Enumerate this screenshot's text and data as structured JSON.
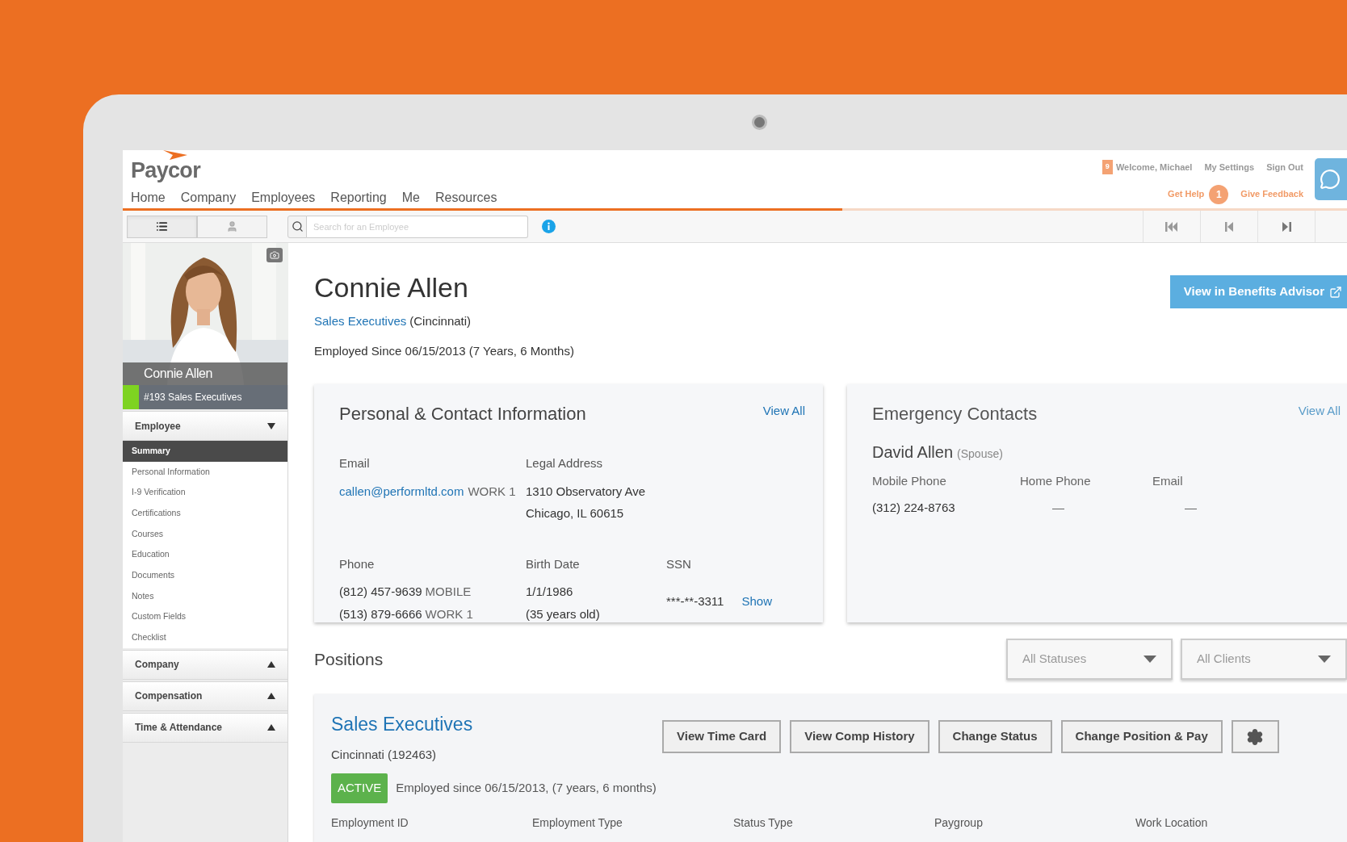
{
  "header": {
    "logo": "Paycor",
    "nav": [
      "Home",
      "Company",
      "Employees",
      "Reporting",
      "Me",
      "Resources"
    ],
    "notification_count": "9",
    "welcome": "Welcome, Michael",
    "links": [
      "My Settings",
      "Sign Out"
    ],
    "get_help": "Get Help",
    "help_count": "1",
    "give_feedback": "Give Feedback"
  },
  "toolbar": {
    "views": [
      {
        "kind": "list",
        "selected": true
      },
      {
        "kind": "person",
        "selected": false
      }
    ],
    "search": {
      "placeholder": "Search for an Employee"
    }
  },
  "sidebar": {
    "name": "Connie Allen",
    "subtitle": "#193 Sales Executives",
    "sections": [
      {
        "label": "Employee",
        "expanded": true,
        "items": [
          {
            "label": "Summary",
            "selected": true
          },
          {
            "label": "Personal Information",
            "selected": false
          },
          {
            "label": "I-9 Verification",
            "selected": false
          },
          {
            "label": "Certifications",
            "selected": false
          },
          {
            "label": "Courses",
            "selected": false
          },
          {
            "label": "Education",
            "selected": false
          },
          {
            "label": "Documents",
            "selected": false
          },
          {
            "label": "Notes",
            "selected": false
          },
          {
            "label": "Custom Fields",
            "selected": false
          },
          {
            "label": "Checklist",
            "selected": false
          }
        ]
      },
      {
        "label": "Company",
        "expanded": false
      },
      {
        "label": "Compensation",
        "expanded": false
      },
      {
        "label": "Time & Attendance",
        "expanded": false
      }
    ]
  },
  "profile": {
    "name": "Connie Allen",
    "department": "Sales Executives",
    "location": "(Cincinnati)",
    "employed_since": "Employed Since 06/15/2013 (7 Years, 6 Months)",
    "benefits_button": "View in Benefits Advisor"
  },
  "personal_card": {
    "title": "Personal & Contact Information",
    "view_all": "View All",
    "email_label": "Email",
    "email": "callen@performltd.com",
    "email_type": "WORK 1",
    "address_label": "Legal Address",
    "address_lines": [
      "1310 Observatory Ave",
      "Chicago, IL 60615"
    ],
    "phone_label": "Phone",
    "phones": [
      {
        "number": "(812) 457-9639",
        "type": "MOBILE"
      },
      {
        "number": "(513) 879-6666",
        "type": "WORK 1"
      }
    ],
    "birth_label": "Birth Date",
    "birth_date": "1/1/1986",
    "age": "(35 years old)",
    "ssn_label": "SSN",
    "ssn": "***-**-3311",
    "ssn_show": "Show"
  },
  "emergency_card": {
    "title": "Emergency Contacts",
    "view_all": "View All",
    "contact_name": "David Allen",
    "relation": "(Spouse)",
    "columns": [
      {
        "label": "Mobile Phone",
        "value": "(312) 224-8763"
      },
      {
        "label": "Home Phone",
        "value": "—"
      },
      {
        "label": "Email",
        "value": "—"
      }
    ]
  },
  "positions": {
    "title": "Positions",
    "filters": [
      "All Statuses",
      "All Clients"
    ],
    "position": {
      "title": "Sales Executives",
      "subtitle": "Cincinnati (192463)",
      "buttons": [
        "View Time Card",
        "View Comp History",
        "Change Status",
        "Change Position & Pay"
      ],
      "status": "ACTIVE",
      "employed": "Employed since 06/15/2013, (7 years, 6 months)",
      "columns": [
        "Employment ID",
        "Employment Type",
        "Status Type",
        "Paygroup",
        "Work Location"
      ]
    }
  }
}
